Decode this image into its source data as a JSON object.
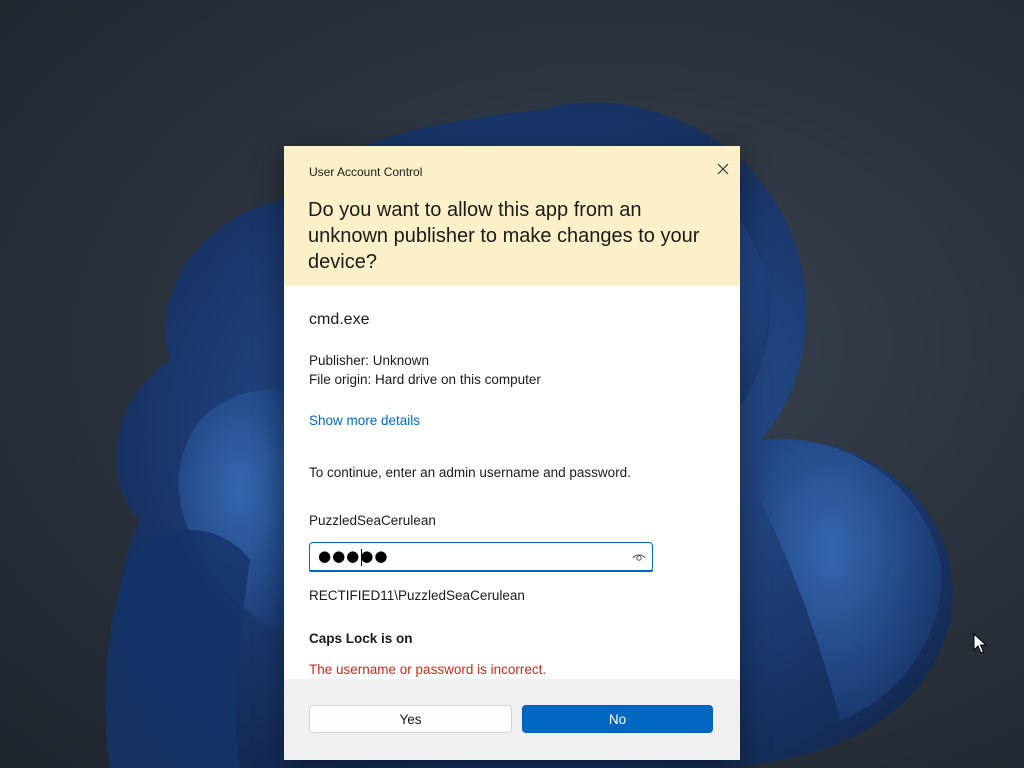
{
  "dialog": {
    "title": "User Account Control",
    "question": "Do you want to allow this app from an unknown publisher to make changes to your device?",
    "app_name": "cmd.exe",
    "publisher": "Publisher: Unknown",
    "file_origin": "File origin: Hard drive on this computer",
    "details_link": "Show more details",
    "instructions": "To continue, enter an admin username and password.",
    "username": "PuzzledSeaCerulean",
    "password_mask": "●●●●●",
    "domain_user": "RECTIFIED11\\PuzzledSeaCerulean",
    "caps_lock_warning": "Caps Lock is on",
    "error_message": "The username or password is incorrect.",
    "yes_label": "Yes",
    "no_label": "No"
  },
  "icons": {
    "close": "close-icon",
    "reveal_password": "eye-icon",
    "cursor": "mouse-pointer-icon"
  },
  "colors": {
    "header_background": "#fcf0c8",
    "accent": "#0067c0",
    "error": "#c42b1c",
    "button_bar": "#f0f0f0"
  }
}
